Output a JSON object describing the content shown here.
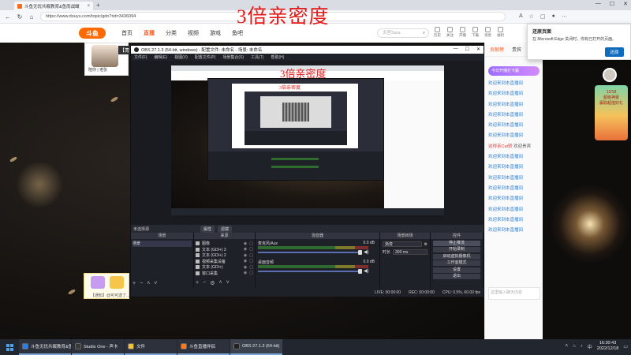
{
  "overlay_title": "3倍亲密度",
  "browser": {
    "tab_title": "斗鱼无忧共眠教育&鱼雨战瞰",
    "url": "https://www.douyu.com/topic/gdn?rid=3436094",
    "popup_title": "还原页面",
    "popup_body": "在 Microsoft Edge 关闭时，你有已打开的页面。",
    "popup_button": "还原"
  },
  "douyu": {
    "logo": "斗鱼",
    "nav": [
      "首页",
      "直播",
      "分类",
      "视频",
      "游戏",
      "鱼吧"
    ],
    "search_placeholder": "天官Sara",
    "header_icons": [
      "历史",
      "关注",
      "开播",
      "下载",
      "消息",
      "福利"
    ],
    "anchor_tag": "【青",
    "anchor_name": "陪你 | 老张",
    "gift_card_text": "【通知】@可可送了..."
  },
  "chat": {
    "tabs": [
      "贡献榜",
      "贵宾"
    ],
    "banner": "今日开播打卡赢",
    "messages": [
      {
        "user": "欢迎来到本直播间",
        "text": ""
      },
      {
        "user": "欢迎来到本直播间",
        "text": ""
      },
      {
        "user": "欢迎来到本直播间",
        "text": ""
      },
      {
        "user": "欢迎来到本直播间",
        "text": ""
      },
      {
        "user": "欢迎来到本直播间",
        "text": ""
      },
      {
        "user": "欢迎来到本直播间",
        "text": ""
      },
      {
        "user": "这得亲Cat轿",
        "text": "欢迎贵宾"
      },
      {
        "user": "欢迎来到本直播间",
        "text": ""
      },
      {
        "user": "欢迎来到本直播间",
        "text": ""
      },
      {
        "user": "欢迎来到本直播间",
        "text": ""
      },
      {
        "user": "欢迎来到本直播间",
        "text": ""
      },
      {
        "user": "欢迎来到本直播间",
        "text": ""
      },
      {
        "user": "欢迎来到本直播间",
        "text": ""
      },
      {
        "user": "欢迎来到本直播间",
        "text": ""
      },
      {
        "user": "欢迎来到本直播间",
        "text": ""
      }
    ],
    "input_placeholder": "这里输入聊天内容",
    "send_label": "发送"
  },
  "promo": {
    "line1": "12/18",
    "line2": "超级神豪",
    "line3": "赢取超值好礼"
  },
  "obs": {
    "title": "OBS 27.1.3 (64-bit, windows) - 配置文件: 未命名 - 场景: 未命名",
    "menu": [
      "文件(F)",
      "编辑(E)",
      "视图(V)",
      "配置文件(P)",
      "场景集合(S)",
      "工具(T)",
      "帮助(H)"
    ],
    "no_source": "未选择源",
    "scene_bar_buttons": [
      "属性",
      "滤镜"
    ],
    "docks": {
      "scenes": "场景",
      "sources": "来源",
      "mixer": "混音器",
      "transitions": "场景转场",
      "controls": "控件"
    },
    "scene_list": [
      "场景"
    ],
    "source_list": [
      "图像",
      "文本 (GDI+) 3",
      "文本 (GDI+) 2",
      "视频采集设备",
      "文本 (GDI+)",
      "窗口采集"
    ],
    "mixer_channels": [
      {
        "name": "麦克风/Aux",
        "db": "0.0 dB"
      },
      {
        "name": "桌面音频",
        "db": "0.0 dB"
      }
    ],
    "transition_type": "渐变",
    "duration_label": "时长",
    "duration_value": "300 ms",
    "controls": [
      "停止推流",
      "开始录制",
      "启动虚拟摄像机",
      "工作室模式",
      "设置",
      "退出"
    ],
    "status": [
      "LIVE: 00:00:00",
      "REC: 00:00:00",
      "CPU: 0.5%, 60.00 fps"
    ]
  },
  "taskbar": {
    "tasks": [
      "斗鱼无忧共眠教育&鱼雨战瞰",
      "Studio One - 声卡",
      "文件",
      "斗鱼直播伴侣",
      "OBS 27.1.3 (64-bit)"
    ],
    "time": "16:30:43",
    "date": "2022/12/18"
  }
}
